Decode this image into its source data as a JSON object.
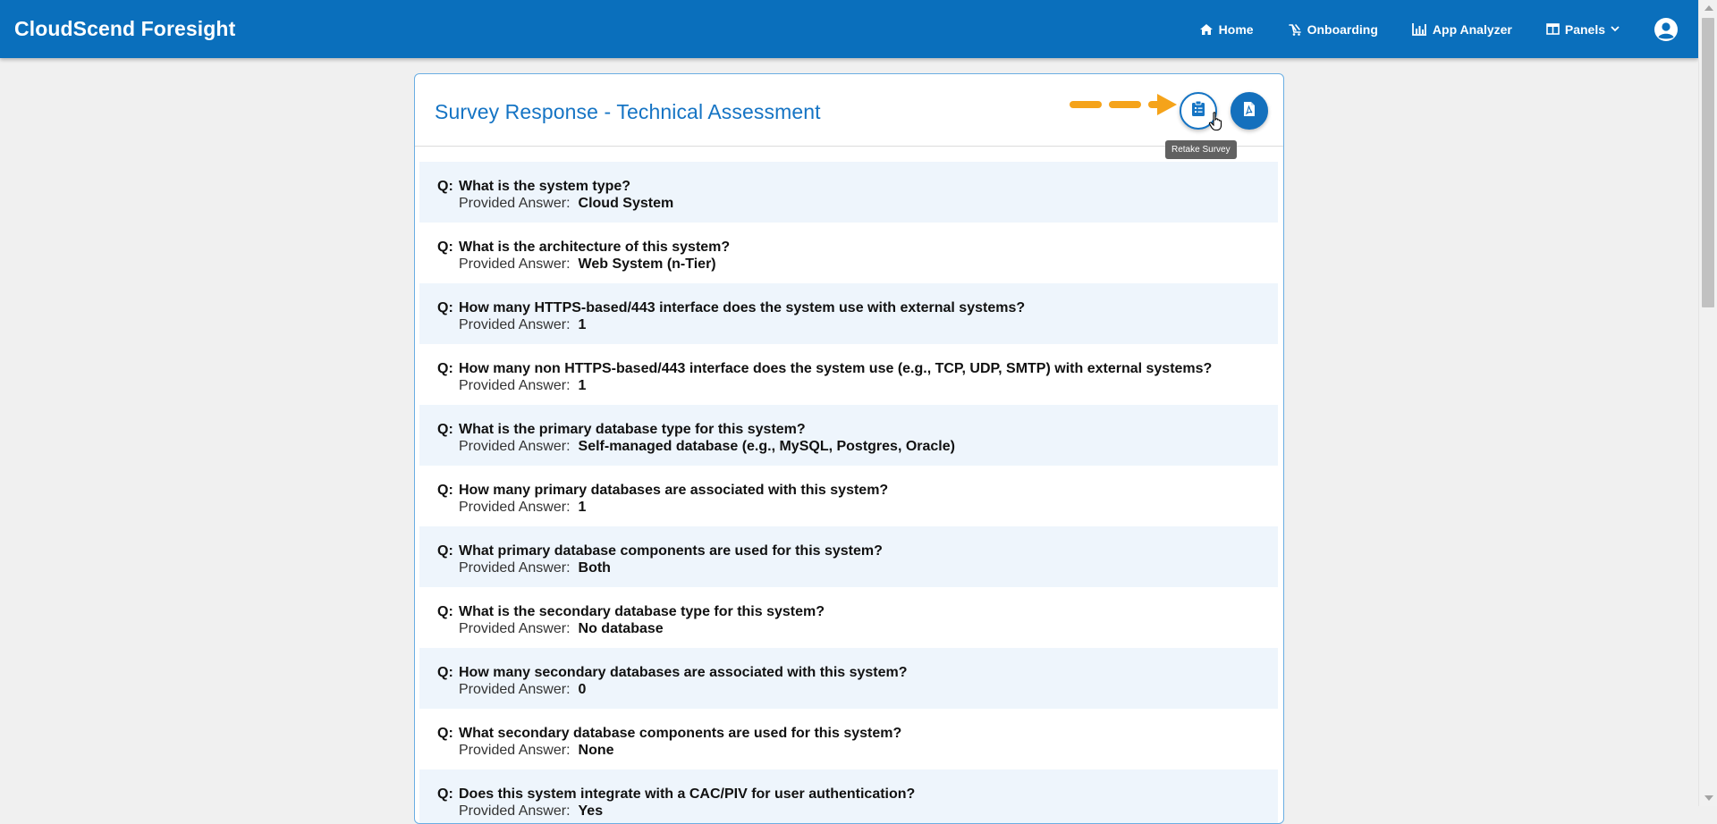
{
  "app": {
    "brand": "CloudScend Foresight"
  },
  "nav": {
    "items": [
      {
        "label": "Home",
        "icon": "home-icon"
      },
      {
        "label": "Onboarding",
        "icon": "onboarding-icon"
      },
      {
        "label": "App Analyzer",
        "icon": "chart-icon"
      },
      {
        "label": "Panels",
        "icon": "panels-icon"
      }
    ],
    "user_icon": "user-circle-icon"
  },
  "card": {
    "title": "Survey Response - Technical Assessment",
    "retake_tooltip": "Retake Survey",
    "retake_icon": "clipboard-icon",
    "pdf_icon": "pdf-icon",
    "accent_color": "#1574c4",
    "annotation_color": "#f5a31a"
  },
  "survey": {
    "question_prefix": "Q:",
    "answer_label": "Provided Answer:",
    "items": [
      {
        "question": "What is the system type?",
        "answer": "Cloud System"
      },
      {
        "question": "What is the architecture of this system?",
        "answer": "Web System (n-Tier)"
      },
      {
        "question": "How many HTTPS-based/443 interface does the system use with external systems?",
        "answer": "1"
      },
      {
        "question": "How many non HTTPS-based/443 interface does the system use (e.g., TCP, UDP, SMTP) with external systems?",
        "answer": "1"
      },
      {
        "question": "What is the primary database type for this system?",
        "answer": "Self-managed database (e.g., MySQL, Postgres, Oracle)"
      },
      {
        "question": "How many primary databases are associated with this system?",
        "answer": "1"
      },
      {
        "question": "What primary database components are used for this system?",
        "answer": "Both"
      },
      {
        "question": "What is the secondary database type for this system?",
        "answer": "No database"
      },
      {
        "question": "How many secondary databases are associated with this system?",
        "answer": "0"
      },
      {
        "question": "What secondary database components are used for this system?",
        "answer": "None"
      },
      {
        "question": "Does this system integrate with a CAC/PIV for user authentication?",
        "answer": "Yes"
      }
    ]
  }
}
